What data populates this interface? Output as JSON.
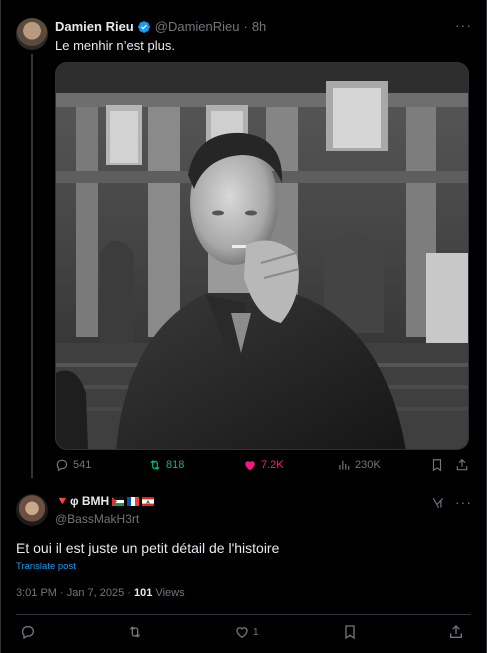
{
  "parent_tweet": {
    "author_name": "Damien Rieu",
    "handle": "@DamienRieu",
    "separator": "·",
    "time": "8h",
    "text": "Le menhir n’est plus.",
    "stats": {
      "replies": "541",
      "retweets": "818",
      "likes": "7.2K",
      "views": "230K"
    },
    "icons": [
      "verified-badge-icon",
      "more-icon",
      "reply-icon",
      "retweet-icon",
      "heart-icon",
      "views-icon",
      "bookmark-icon",
      "share-icon"
    ]
  },
  "reply_tweet": {
    "author_name": "🔻φ BMH",
    "handle": "@BassMakH3rt",
    "text": "Et oui il est juste un petit détail de l'histoire",
    "translate_label": "Translate post",
    "timestamp": "3:01 PM · Jan 7, 2025 · ",
    "views_count": "101",
    "views_label": "Views",
    "like_count": "1",
    "icons": [
      "grok-icon",
      "more-icon",
      "reply-icon",
      "retweet-icon",
      "heart-icon",
      "bookmark-icon",
      "share-icon"
    ]
  },
  "colors": {
    "background": "#000000",
    "text": "#e7e9ea",
    "muted": "#71767b",
    "link": "#1d9bf0",
    "retweet_active": "#00ba7c",
    "like_active": "#f91880",
    "verified": "#1d9bf0"
  }
}
